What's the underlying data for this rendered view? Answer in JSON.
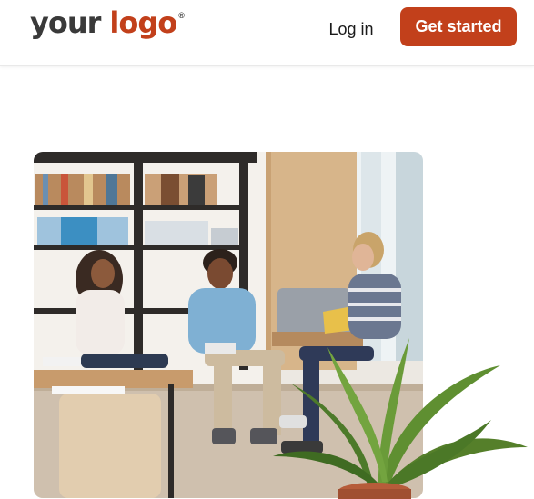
{
  "header": {
    "logo": {
      "word1": "your",
      "word2": "logo",
      "mark": "®"
    },
    "login_label": "Log in",
    "cta_label": "Get started"
  },
  "colors": {
    "brand": "#c2401b",
    "logo_dark": "#3a3a3a",
    "text": "#1a1a1a",
    "background": "#ffffff"
  },
  "hero_image": {
    "subject": "people-meeting-photo",
    "decoration": "potted-plant"
  }
}
